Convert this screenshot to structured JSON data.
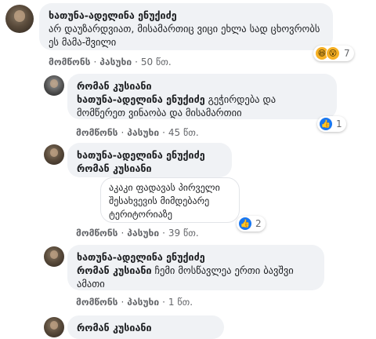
{
  "comments": [
    {
      "author": "ხათუნა-ადელინა ენუქიძე",
      "lines": [
        "არ დაუზარდვიათ, მისამართიც ვიცი ეხლა სად ცხოვრობს",
        "ეს მამა-შვილი"
      ],
      "like_label": "მომწონს",
      "reply_label": "პასუხი",
      "time": "50 წთ.",
      "reaction_count": "7",
      "reaction_icons": [
        "haha-icon",
        "wow-icon"
      ]
    },
    {
      "author": "რომან კუსიანი",
      "tag": "ხათუნა-ადელინა ენუქიძე",
      "lines": [
        "გეჭირდება და",
        "მომწერეთ ვინაობა და მისამართიი"
      ],
      "like_label": "მომწონს",
      "reply_label": "პასუხი",
      "time": "45 წთ.",
      "reaction_count": "1",
      "reaction_icons": [
        "like-icon"
      ]
    },
    {
      "author": "ხათუნა-ადელინა ენუქიძე",
      "tag": "რომან კუსიანი",
      "extra_lines": [
        "აკაკი ფადავას პირველი",
        "შესახვევის მიმდებარე",
        "ტერიტორიაზე"
      ],
      "like_label": "მომწონს",
      "reply_label": "პასუხი",
      "time": "39 წთ.",
      "reaction_count": "2",
      "reaction_icons": [
        "like-icon"
      ]
    },
    {
      "author": "ხათუნა-ადელინა ენუქიძე",
      "tag": "რომან კუსიანი",
      "lines": [
        "ჩემი მოსწავლეა ერთი ბავშვი",
        "ამათი"
      ],
      "like_label": "მომწონს",
      "reply_label": "პასუხი",
      "time": "1 წთ."
    }
  ],
  "partial_author": "რომან კუსიანი"
}
